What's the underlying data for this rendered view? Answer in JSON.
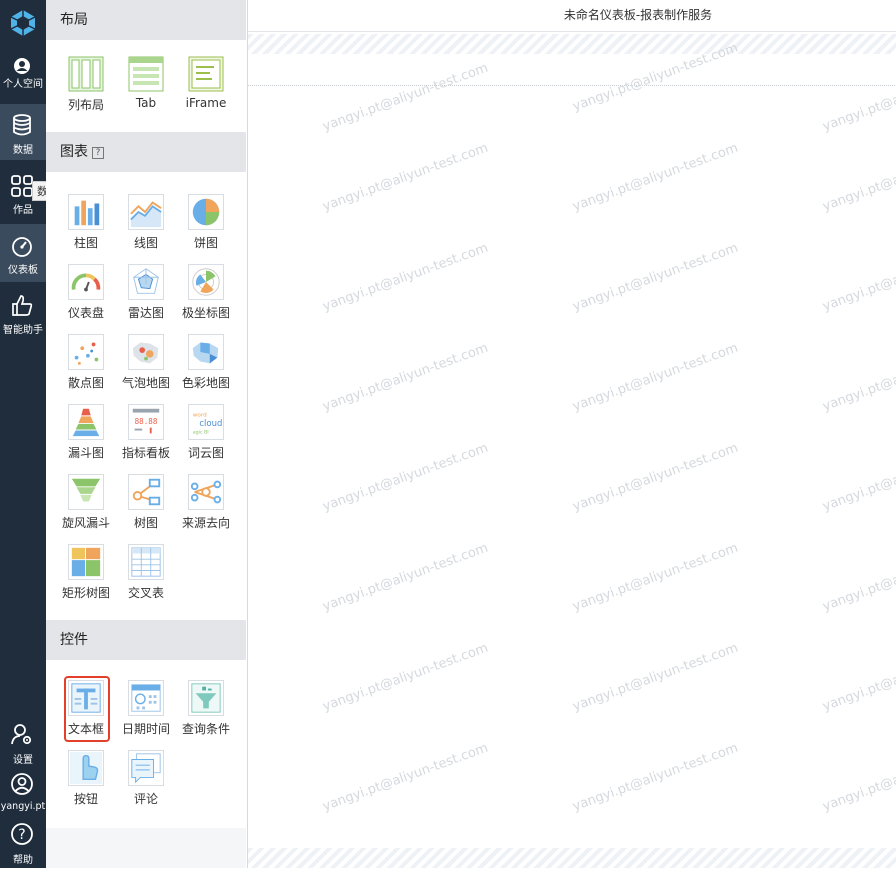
{
  "nav": {
    "items": [
      {
        "label": "个人空间",
        "icon": "user-icon"
      },
      {
        "label": "数据",
        "icon": "database-icon"
      },
      {
        "label": "作品",
        "icon": "grid-icon"
      },
      {
        "label": "仪表板",
        "icon": "dashboard-icon"
      },
      {
        "label": "智能助手",
        "icon": "thumb-up-icon"
      }
    ],
    "tooltip": "数据",
    "bottom": [
      {
        "label": "设置",
        "icon": "settings-user-icon"
      },
      {
        "label": "yangyi.pt",
        "icon": "avatar-icon"
      },
      {
        "label": "帮助",
        "icon": "help-icon"
      }
    ]
  },
  "panel": {
    "layout": {
      "title": "布局",
      "items": [
        {
          "label": "列布局"
        },
        {
          "label": "Tab"
        },
        {
          "label": "iFrame"
        }
      ]
    },
    "charts": {
      "title": "图表",
      "help": "?",
      "items": [
        {
          "label": "柱图"
        },
        {
          "label": "线图"
        },
        {
          "label": "饼图"
        },
        {
          "label": "仪表盘"
        },
        {
          "label": "雷达图"
        },
        {
          "label": "极坐标图"
        },
        {
          "label": "散点图"
        },
        {
          "label": "气泡地图"
        },
        {
          "label": "色彩地图"
        },
        {
          "label": "漏斗图"
        },
        {
          "label": "指标看板"
        },
        {
          "label": "词云图"
        },
        {
          "label": "旋风漏斗"
        },
        {
          "label": "树图"
        },
        {
          "label": "来源去向"
        },
        {
          "label": "矩形树图"
        },
        {
          "label": "交叉表"
        }
      ]
    },
    "controls": {
      "title": "控件",
      "items": [
        {
          "label": "文本框"
        },
        {
          "label": "日期时间"
        },
        {
          "label": "查询条件"
        },
        {
          "label": "按钮"
        },
        {
          "label": "评论"
        }
      ]
    }
  },
  "canvas": {
    "title": "未命名仪表板-报表制作服务",
    "watermark": "yangyi.pt@aliyun-test.com"
  },
  "colors": {
    "nav_bg": "#1f2d3d",
    "nav_active": "#3b4b5e",
    "highlight": "#e2402b"
  }
}
